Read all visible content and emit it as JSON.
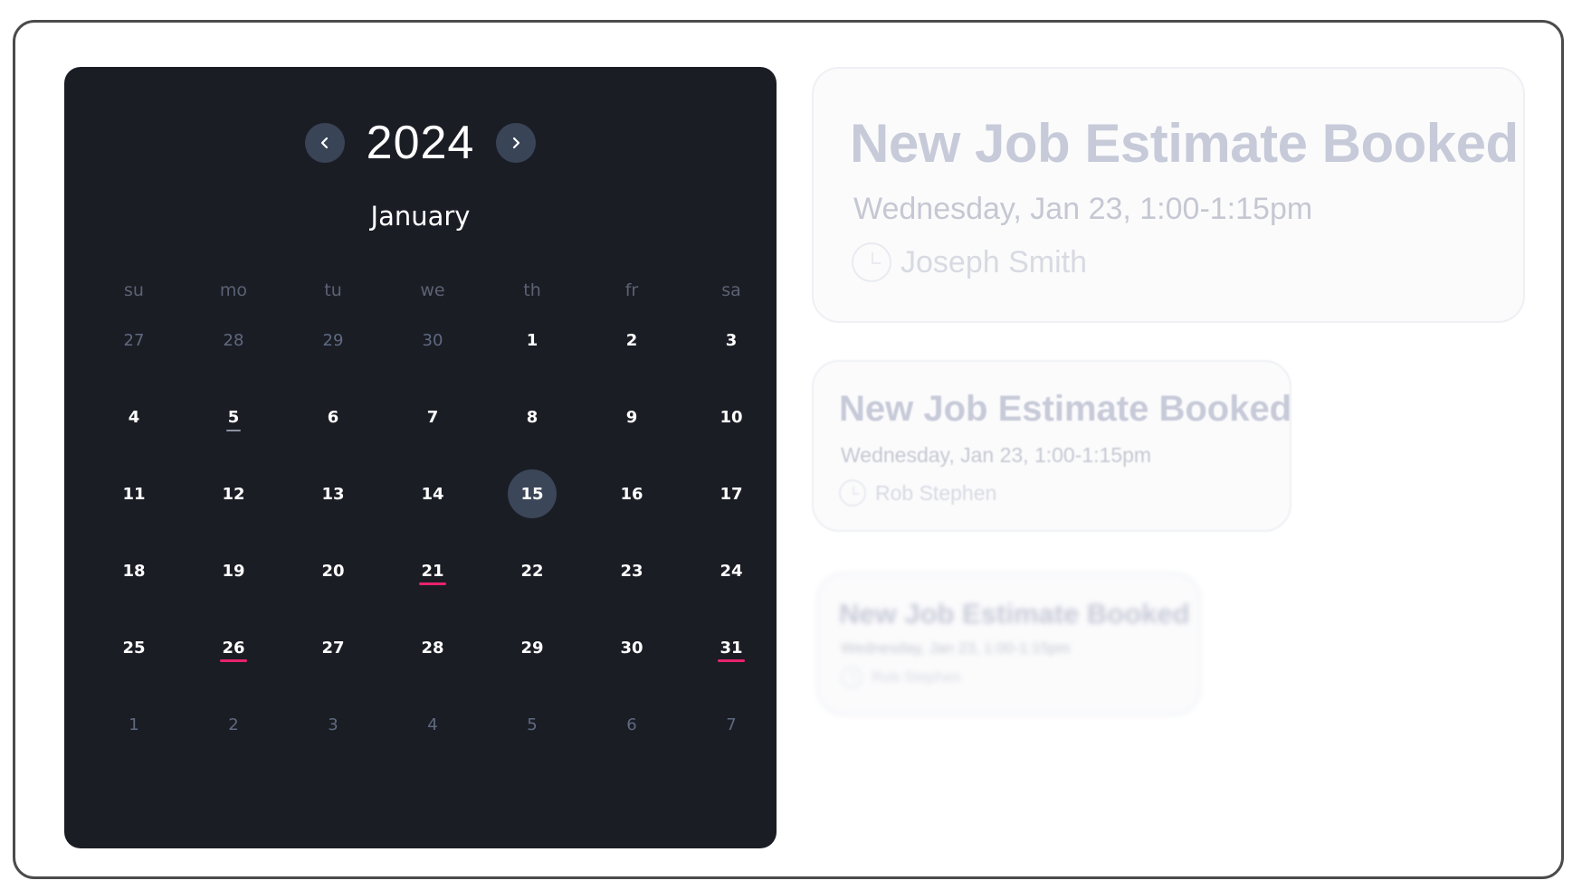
{
  "calendar": {
    "year": "2024",
    "month": "January",
    "weekdays": [
      "su",
      "mo",
      "tu",
      "we",
      "th",
      "fr",
      "sa"
    ],
    "weeks": [
      [
        {
          "d": "27",
          "muted": true
        },
        {
          "d": "28",
          "muted": true
        },
        {
          "d": "29",
          "muted": true
        },
        {
          "d": "30",
          "muted": true
        },
        {
          "d": "1"
        },
        {
          "d": "2"
        },
        {
          "d": "3"
        }
      ],
      [
        {
          "d": "4"
        },
        {
          "d": "5",
          "mark": "gray"
        },
        {
          "d": "6"
        },
        {
          "d": "7"
        },
        {
          "d": "8"
        },
        {
          "d": "9"
        },
        {
          "d": "10"
        }
      ],
      [
        {
          "d": "11"
        },
        {
          "d": "12"
        },
        {
          "d": "13"
        },
        {
          "d": "14"
        },
        {
          "d": "15",
          "selected": true
        },
        {
          "d": "16"
        },
        {
          "d": "17"
        }
      ],
      [
        {
          "d": "18"
        },
        {
          "d": "19"
        },
        {
          "d": "20"
        },
        {
          "d": "21",
          "mark": "pink"
        },
        {
          "d": "22"
        },
        {
          "d": "23"
        },
        {
          "d": "24"
        }
      ],
      [
        {
          "d": "25"
        },
        {
          "d": "26",
          "mark": "pink"
        },
        {
          "d": "27"
        },
        {
          "d": "28"
        },
        {
          "d": "29"
        },
        {
          "d": "30"
        },
        {
          "d": "31",
          "mark": "pink"
        }
      ],
      [
        {
          "d": "1",
          "muted": true
        },
        {
          "d": "2",
          "muted": true
        },
        {
          "d": "3",
          "muted": true
        },
        {
          "d": "4",
          "muted": true
        },
        {
          "d": "5",
          "muted": true
        },
        {
          "d": "6",
          "muted": true
        },
        {
          "d": "7",
          "muted": true
        }
      ]
    ],
    "prev_icon": "chevron-left-icon",
    "next_icon": "chevron-right-icon",
    "colors": {
      "panel": "#1b1d25",
      "selected": "#3c4659",
      "event_mark": "#e8226f"
    }
  },
  "notifications": [
    {
      "title": "New Job Estimate Booked",
      "time": "Wednesday, Jan 23, 1:00-1:15pm",
      "person": "Joseph Smith",
      "icon": "clock-icon"
    },
    {
      "title": "New Job Estimate Booked",
      "time": "Wednesday, Jan 23, 1:00-1:15pm",
      "person": "Rob Stephen",
      "icon": "clock-icon"
    },
    {
      "title": "New Job Estimate Booked",
      "time": "Wednesday, Jan 23, 1:00-1:15pm",
      "person": "Rob Stephen",
      "icon": "clock-icon"
    }
  ]
}
